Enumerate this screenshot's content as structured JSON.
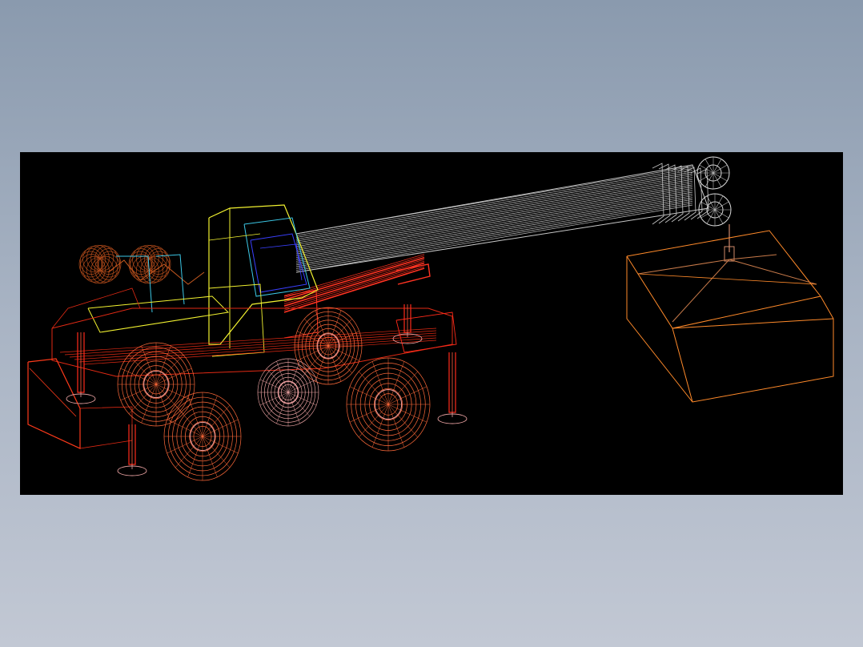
{
  "canvas": {
    "background": "#000000",
    "page_background_top": "#8a9aae",
    "page_background_bottom": "#c2c8d4"
  },
  "model": {
    "subject": "rough-terrain-mobile-crane-lifting-load",
    "render_mode": "wireframe",
    "colors": {
      "boom": "#c8c8c8",
      "cab": "#f2f230",
      "cab_glass": "#3cc8e6",
      "cab_inner": "#3a40ff",
      "chassis": "#e22a14",
      "wheels": "#ff6a3a",
      "hubs": "#f0a0a0",
      "outriggers": "#ff2a1a",
      "lift_cylinder": "#ff3322",
      "engine": "#b04a1a",
      "load": "#ff8a2a",
      "hook": "#d08a6a"
    }
  }
}
